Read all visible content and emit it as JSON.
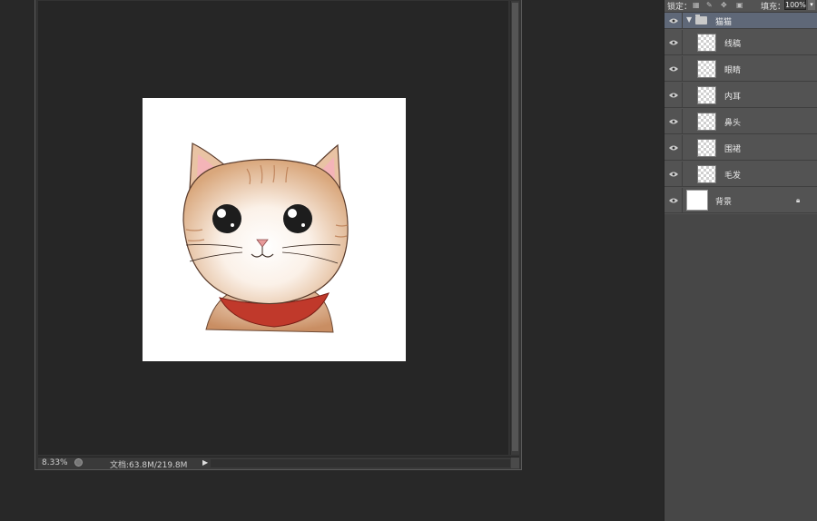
{
  "document": {
    "zoom": "8.33%",
    "doc_size": "文档:63.8M/219.8M"
  },
  "layers_panel": {
    "lock_label": "锁定：",
    "fill_label": "填充：",
    "fill_value": "100%",
    "group": {
      "name": "猫猫",
      "expanded": true
    },
    "layers": [
      {
        "name": "线稿"
      },
      {
        "name": "眼睛"
      },
      {
        "name": "内耳"
      },
      {
        "name": "鼻头"
      },
      {
        "name": "围裙"
      },
      {
        "name": "毛发"
      }
    ],
    "background": {
      "name": "背景",
      "locked": true
    }
  },
  "icons": {
    "eye": "eye-icon",
    "folder": "folder-icon",
    "lock": "lock-icon",
    "status": "document-info-icon",
    "arrow": "triangle-right-icon"
  },
  "colors": {
    "workspace": "#282828",
    "panel": "#535353",
    "group_highlight": "#5f6878"
  }
}
